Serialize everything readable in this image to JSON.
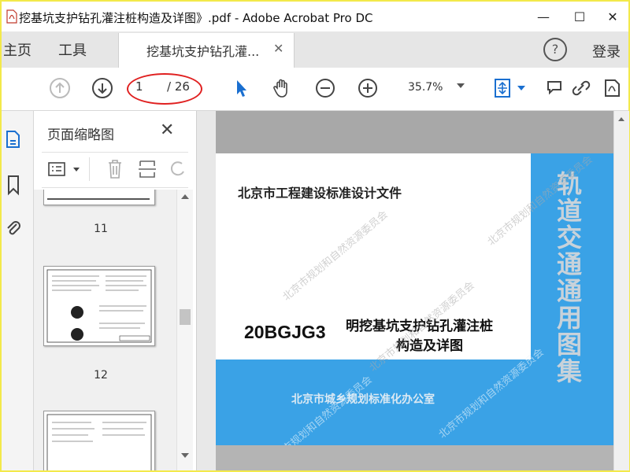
{
  "window": {
    "title": "挖基坑支护钻孔灌注桩构造及详图》.pdf - Adobe Acrobat Pro DC",
    "minimize": "—",
    "maximize": "☐",
    "close": "✕"
  },
  "tabs": {
    "home": "主页",
    "tools": "工具",
    "document": "挖基坑支护钻孔灌...",
    "document_close": "✕",
    "help": "?",
    "login": "登录"
  },
  "toolbar": {
    "current_page": "1",
    "total_pages": "/ 26",
    "zoom": "35.7%"
  },
  "thumbnails": {
    "title": "页面缩略图",
    "close": "✕",
    "pages": [
      "11",
      "12"
    ]
  },
  "document": {
    "org": "北京市工程建设标准设计文件",
    "code": "20BGJG3",
    "title_line1": "明挖基坑支护钻孔灌注桩",
    "title_line2": "构造及详图",
    "series": "轨道交通通用图集",
    "office": "北京市城乡规划标准化办公室",
    "watermark": "北京市规划和自然资源委员会"
  },
  "colors": {
    "accent_blue": "#3aa2e6",
    "highlight_red": "#e02020",
    "frame_yellow": "#f3e94a"
  }
}
